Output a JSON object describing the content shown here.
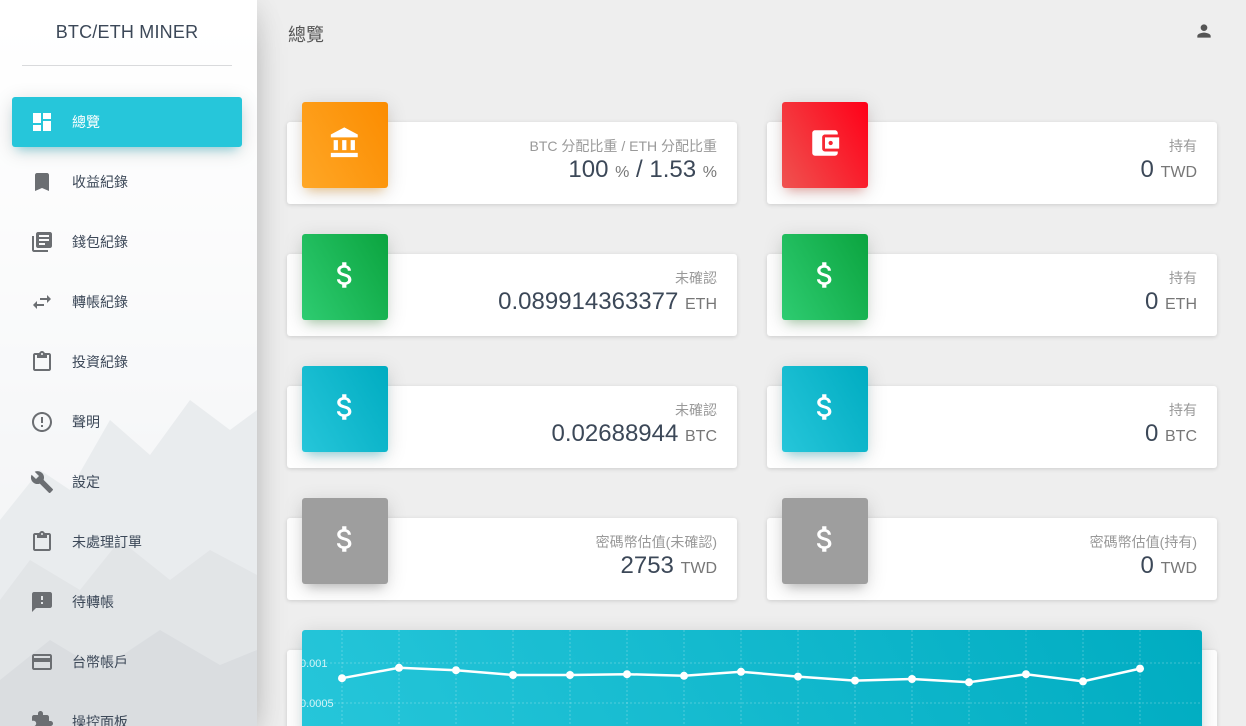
{
  "app": {
    "title": "BTC/ETH MINER"
  },
  "sidebar": {
    "items": [
      {
        "label": "總覽",
        "icon": "dashboard-icon",
        "active": true
      },
      {
        "label": "收益紀錄",
        "icon": "bookmark-icon"
      },
      {
        "label": "錢包紀錄",
        "icon": "library-books-icon"
      },
      {
        "label": "轉帳紀錄",
        "icon": "swap-horiz-icon"
      },
      {
        "label": "投資紀錄",
        "icon": "clipboard-icon"
      },
      {
        "label": "聲明",
        "icon": "info-outline-icon"
      },
      {
        "label": "設定",
        "icon": "wrench-icon"
      },
      {
        "label": "未處理訂單",
        "icon": "clipboard-icon"
      },
      {
        "label": "待轉帳",
        "icon": "feedback-icon"
      },
      {
        "label": "台幣帳戶",
        "icon": "credit-card-icon"
      },
      {
        "label": "操控面板",
        "icon": "extension-icon"
      }
    ]
  },
  "header": {
    "title": "總覽",
    "user_icon": "person-icon"
  },
  "cards": [
    {
      "category": "BTC 分配比重 / ETH 分配比重",
      "value": "100",
      "unit": "%",
      "sep": "/",
      "value2": "1.53",
      "unit2": "%",
      "color": "#fb8c00",
      "icon": "bank-icon"
    },
    {
      "category": "持有",
      "value": "0",
      "unit": "TWD",
      "color": "#ff0018",
      "icon": "wallet-icon"
    },
    {
      "category": "未確認",
      "value": "0.089914363377",
      "unit": "ETH",
      "color": "#0ba43f",
      "icon": "dollar-icon"
    },
    {
      "category": "持有",
      "value": "0",
      "unit": "ETH",
      "color": "#0ba43f",
      "icon": "dollar-icon"
    },
    {
      "category": "未確認",
      "value": "0.02688944",
      "unit": "BTC",
      "color": "#00acc1",
      "icon": "dollar-icon"
    },
    {
      "category": "持有",
      "value": "0",
      "unit": "BTC",
      "color": "#00acc1",
      "icon": "dollar-icon"
    },
    {
      "category": "密碼幣估值(未確認)",
      "value": "2753",
      "unit": "TWD",
      "color": "#9e9e9e",
      "icon": "dollar-icon"
    },
    {
      "category": "密碼幣估值(持有)",
      "value": "0",
      "unit": "TWD",
      "color": "#9e9e9e",
      "icon": "dollar-icon"
    }
  ],
  "chart_data": {
    "type": "line",
    "y_ticks": [
      "0.001",
      "0.0005"
    ],
    "ylim": [
      0,
      0.0013
    ],
    "series": [
      {
        "values": [
          0.00081,
          0.00094,
          0.00091,
          0.00085,
          0.00085,
          0.00086,
          0.00084,
          0.00089,
          0.00083,
          0.00078,
          0.0008,
          0.00076,
          0.00086,
          0.00077,
          0.00093
        ]
      }
    ],
    "grid": true,
    "line_color": "#ffffff"
  }
}
